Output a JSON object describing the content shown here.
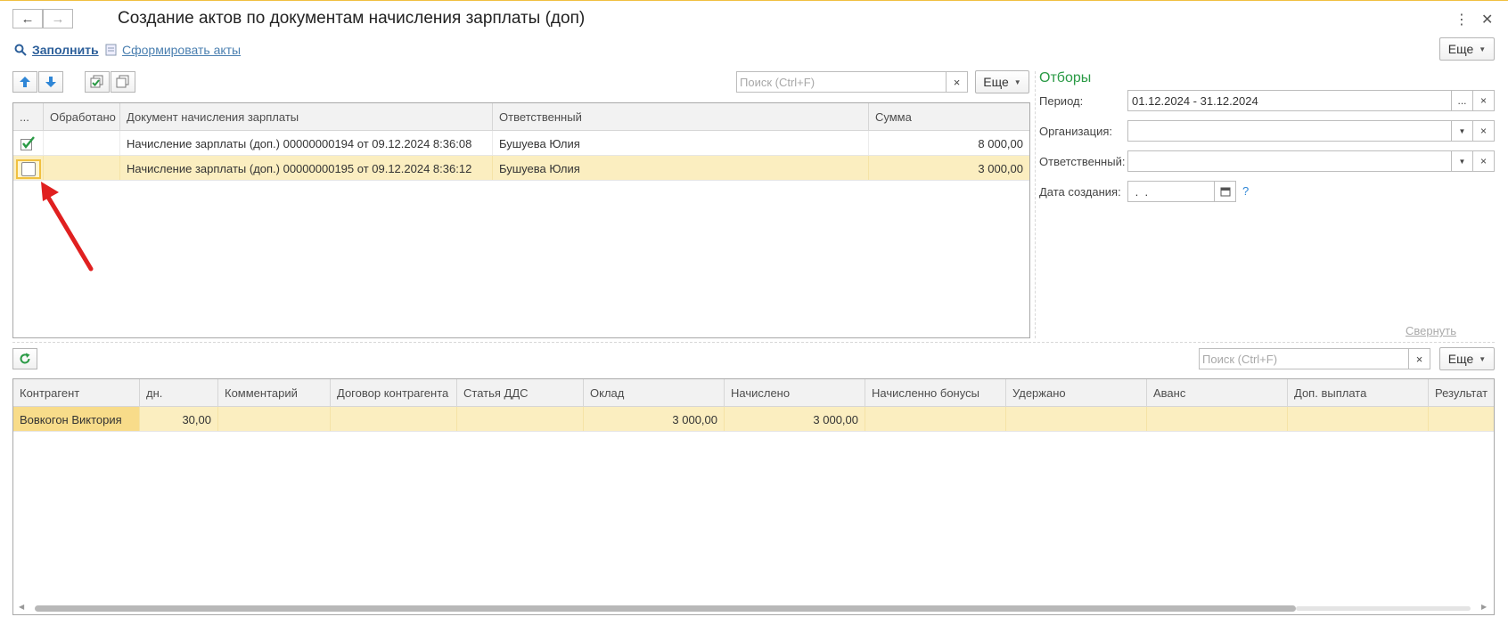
{
  "window": {
    "title": "Создание актов по документам начисления зарплаты (доп)",
    "back_icon": "arrow-left-icon",
    "forward_icon": "arrow-right-icon",
    "more_icon": "kebab-icon",
    "close_icon": "close-icon"
  },
  "command_bar": {
    "fill_label": "Заполнить",
    "form_acts_label": "Сформировать акты",
    "more_label": "Еще"
  },
  "docs_toolbar": {
    "search_placeholder": "Поиск (Ctrl+F)",
    "search_clear": "×",
    "more_label": "Еще"
  },
  "docs_table": {
    "columns": [
      "...",
      "Обработано",
      "Документ начисления зарплаты",
      "Ответственный",
      "Сумма"
    ],
    "rows": [
      {
        "checked": true,
        "processed": "",
        "document": "Начисление зарплаты (доп.) 00000000194 от 09.12.2024 8:36:08",
        "responsible": "Бушуева Юлия",
        "sum": "8 000,00"
      },
      {
        "checked": false,
        "processed": "",
        "document": "Начисление зарплаты (доп.) 00000000195 от 09.12.2024 8:36:12",
        "responsible": "Бушуева Юлия",
        "sum": "3 000,00"
      }
    ]
  },
  "filters": {
    "title": "Отборы",
    "period_label": "Период:",
    "period_value": "01.12.2024 - 31.12.2024",
    "org_label": "Организация:",
    "org_value": "",
    "resp_label": "Ответственный:",
    "resp_value": "",
    "date_label": "Дата создания:",
    "date_value": " .  .",
    "help": "?",
    "collapse_label": "Свернуть"
  },
  "details_toolbar": {
    "search_placeholder": "Поиск (Ctrl+F)",
    "search_clear": "×",
    "more_label": "Еще"
  },
  "details_table": {
    "columns": [
      "Контрагент",
      "дн.",
      "Комментарий",
      "Договор контрагента",
      "Статья ДДС",
      "Оклад",
      "Начислено",
      "Начисленно бонусы",
      "Удержано",
      "Аванс",
      "Доп. выплата",
      "Результат"
    ],
    "rows": [
      {
        "counterparty": "Вовкогон Виктория",
        "days": "30,00",
        "comment": "",
        "contract": "",
        "dds": "",
        "salary": "3 000,00",
        "accrued": "3 000,00",
        "bonus": "",
        "withheld": "",
        "advance": "",
        "extra": "",
        "result": ""
      }
    ]
  },
  "colors": {
    "accent_green": "#2a9a45",
    "selection": "#fbeec0",
    "annotation_arrow": "#e02020"
  }
}
